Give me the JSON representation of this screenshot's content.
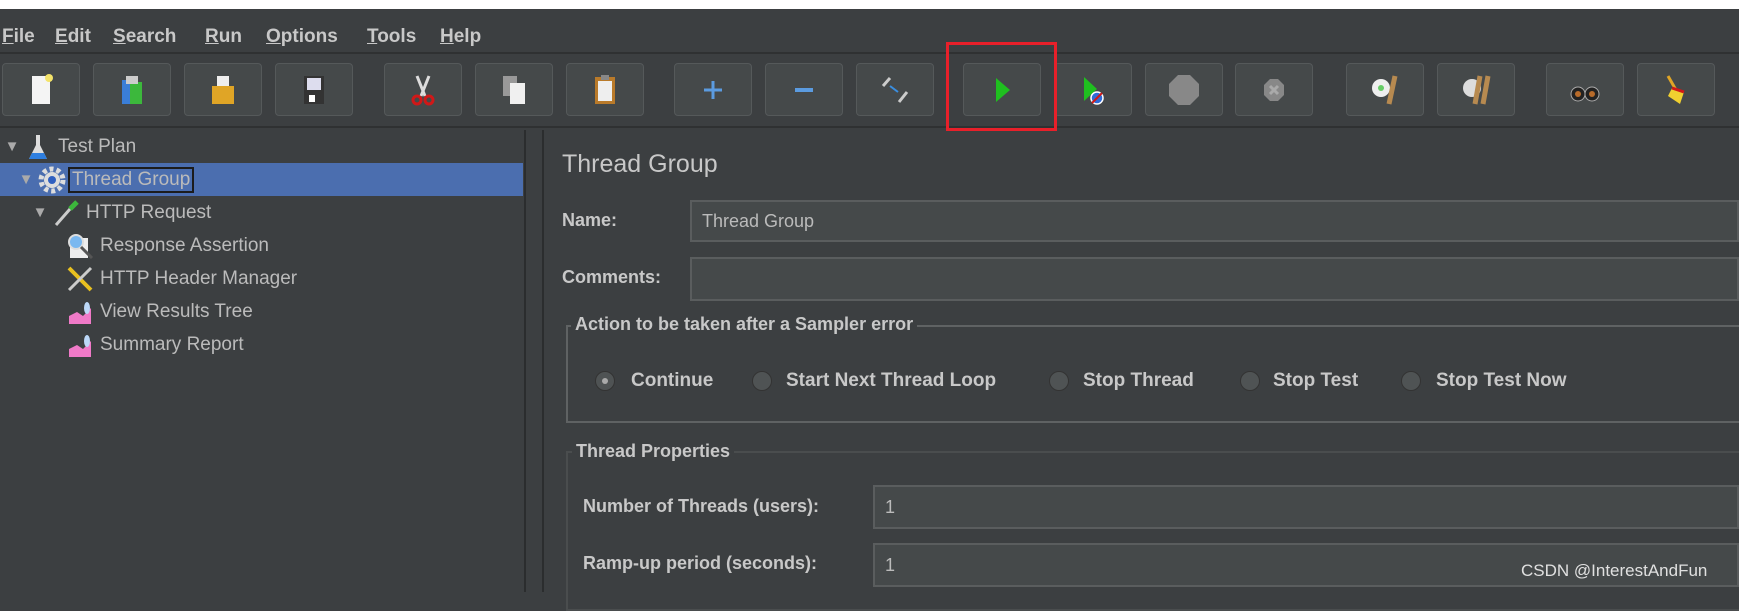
{
  "menu": [
    {
      "label": "File",
      "mn": "F",
      "rest": "ile"
    },
    {
      "label": "Edit",
      "mn": "E",
      "rest": "dit"
    },
    {
      "label": "Search",
      "mn": "S",
      "rest": "earch"
    },
    {
      "label": "Run",
      "mn": "R",
      "rest": "un"
    },
    {
      "label": "Options",
      "mn": "O",
      "rest": "ptions"
    },
    {
      "label": "Tools",
      "mn": "T",
      "rest": "ools"
    },
    {
      "label": "Help",
      "mn": "H",
      "rest": "elp"
    }
  ],
  "toolbar": [
    "new-icon",
    "templates-icon",
    "open-icon",
    "save-icon",
    "cut-icon",
    "copy-icon",
    "paste-icon",
    "expand-icon",
    "collapse-icon",
    "toggle-icon",
    "start-icon",
    "start-no-pauses-icon",
    "stop-icon",
    "shutdown-icon",
    "clear-icon",
    "clear-all-icon",
    "search-icon",
    "reset-search-icon"
  ],
  "highlight_color": "#e8202a",
  "tree": [
    {
      "label": "Test Plan",
      "icon": "flask-icon",
      "expanded": true
    },
    {
      "label": "Thread Group",
      "icon": "gear-icon",
      "expanded": true,
      "selected": true
    },
    {
      "label": "HTTP Request",
      "icon": "pipette-icon",
      "expanded": true
    },
    {
      "label": "Response Assertion",
      "icon": "magnifier-icon"
    },
    {
      "label": "HTTP Header Manager",
      "icon": "tools-icon"
    },
    {
      "label": "View Results Tree",
      "icon": "graph-icon"
    },
    {
      "label": "Summary Report",
      "icon": "graph-icon"
    }
  ],
  "panel": {
    "title": "Thread Group",
    "name_label": "Name:",
    "name_value": "Thread Group",
    "comments_label": "Comments:",
    "comments_value": "",
    "error_group": {
      "legend": "Action to be taken after a Sampler error",
      "options": [
        "Continue",
        "Start Next Thread Loop",
        "Stop Thread",
        "Stop Test",
        "Stop Test Now"
      ],
      "selected": "Continue"
    },
    "thread_props": {
      "legend": "Thread Properties",
      "threads_label": "Number of Threads (users):",
      "threads_value": "1",
      "rampup_label": "Ramp-up period (seconds):",
      "rampup_value": "1"
    }
  },
  "watermark": "CSDN @InterestAndFun"
}
